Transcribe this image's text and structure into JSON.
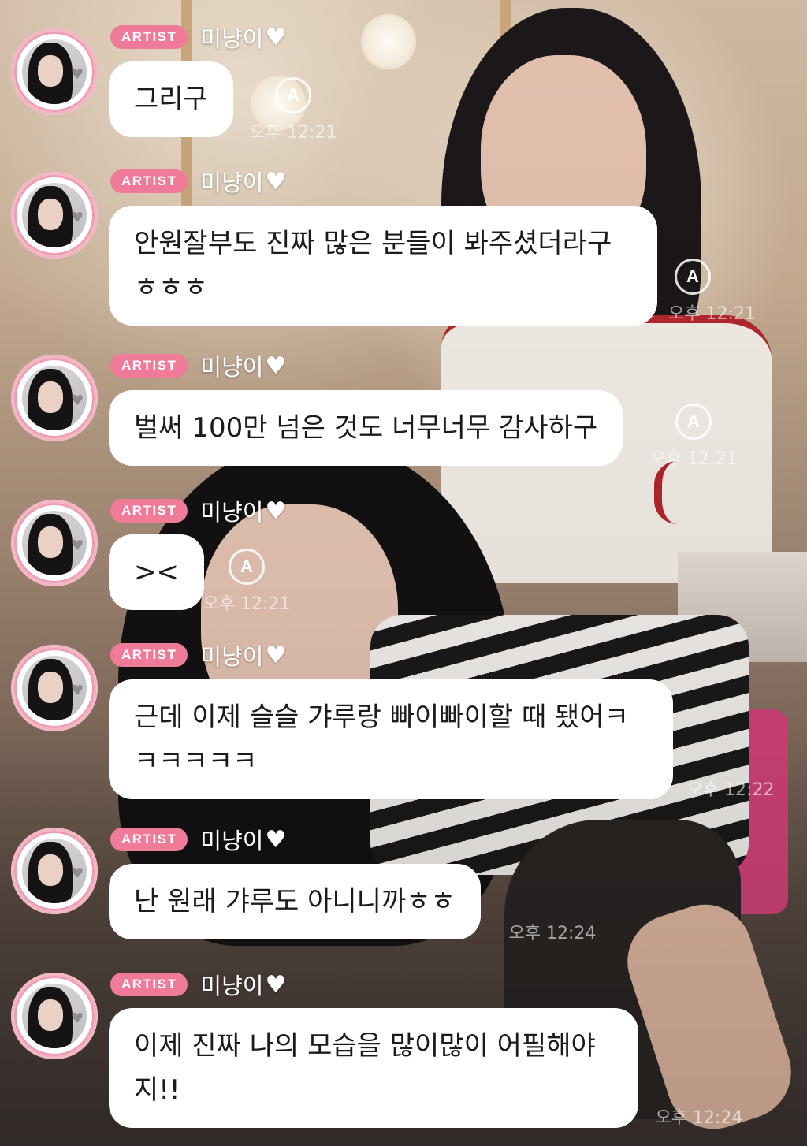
{
  "colors": {
    "badge": "#f07b98",
    "bubble": "#ffffff",
    "avatar_ring": "#ef9db2"
  },
  "icons": {
    "nickname_heart": "white-heart-icon",
    "translate": "translate-a-icon"
  },
  "messages": [
    {
      "badge": "ARTIST",
      "nickname": "미냥이",
      "text": "그리구",
      "time": "오후 12:21",
      "translate_label": "A"
    },
    {
      "badge": "ARTIST",
      "nickname": "미냥이",
      "text": "안원잘부도 진짜 많은 분들이 봐주셨더라구\nㅎㅎㅎ",
      "time": "오후 12:21",
      "translate_label": "A"
    },
    {
      "badge": "ARTIST",
      "nickname": "미냥이",
      "text": "벌써 100만 넘은 것도 너무너무 감사하구",
      "time": "오후 12:21",
      "translate_label": "A"
    },
    {
      "badge": "ARTIST",
      "nickname": "미냥이",
      "text": "><",
      "time": "오후 12:21",
      "translate_label": "A"
    },
    {
      "badge": "ARTIST",
      "nickname": "미냥이",
      "text": "근데 이제 슬슬 갸루랑 빠이빠이할 때 됐어ㅋ\nㅋㅋㅋㅋㅋ",
      "time": "오후 12:22",
      "translate_label": ""
    },
    {
      "badge": "ARTIST",
      "nickname": "미냥이",
      "text": "난 원래 갸루도 아니니까ㅎㅎ",
      "time": "오후 12:24",
      "translate_label": ""
    },
    {
      "badge": "ARTIST",
      "nickname": "미냥이",
      "text": "이제 진짜 나의 모습을 많이많이 어필해야\n지!!",
      "time": "오후 12:24",
      "translate_label": ""
    }
  ]
}
